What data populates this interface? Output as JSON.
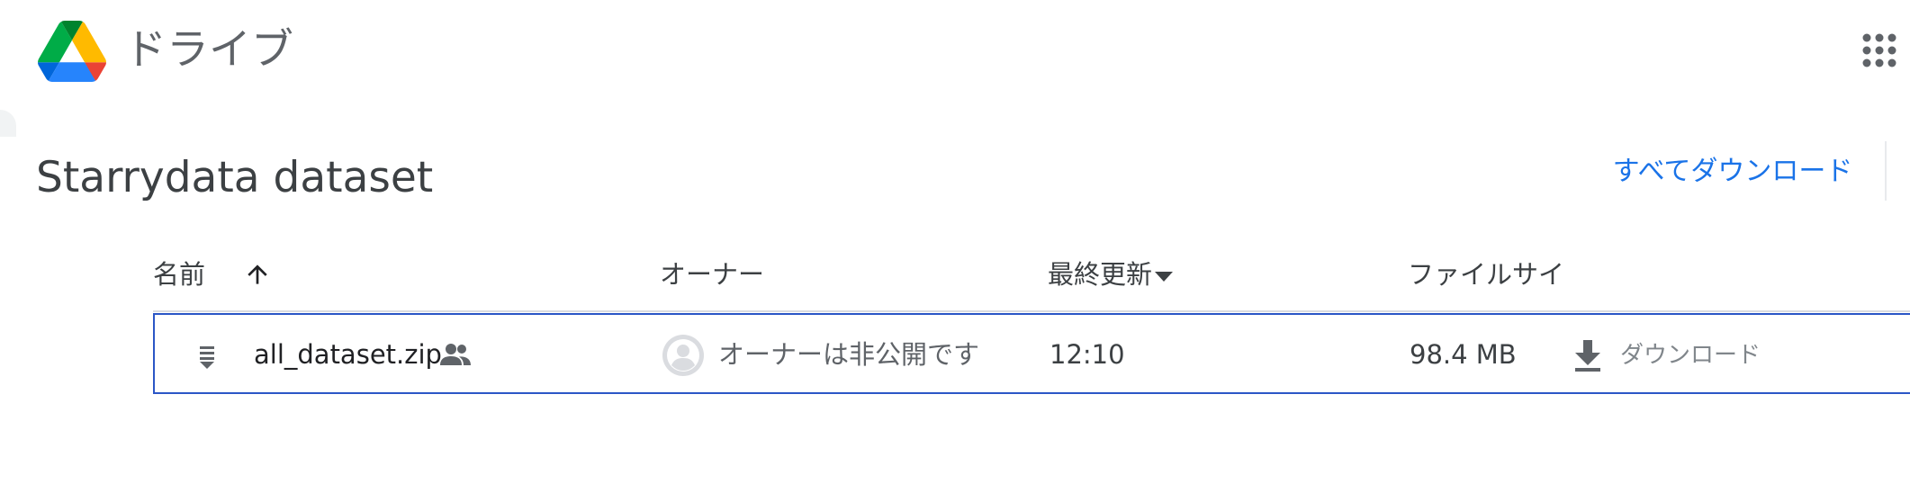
{
  "header": {
    "app_title": "ドライブ",
    "logo_icon": "google-drive-logo",
    "apps_icon": "apps-grid-icon"
  },
  "folder": {
    "title": "Starrydata dataset",
    "download_all_label": "すべてダウンロード"
  },
  "table": {
    "columns": {
      "name": "名前",
      "owner": "オーナー",
      "modified": "最終更新",
      "size": "ファイルサイ"
    },
    "sort": {
      "name_direction": "ascending",
      "modified_indicator": "dropdown"
    },
    "rows": [
      {
        "name": "all_dataset.zip",
        "type_icon": "zip-file-icon",
        "shared_icon": "people-icon",
        "owner": "オーナーは非公開です",
        "owner_icon": "anonymous-avatar-icon",
        "modified": "12:10",
        "size": "98.4 MB",
        "download_label": "ダウンロード",
        "download_icon": "download-icon"
      }
    ]
  },
  "colors": {
    "accent_blue": "#1a73e8",
    "row_border": "#2b56c6",
    "text_primary": "#3c4043",
    "text_secondary": "#5f6368",
    "text_muted": "#80868b"
  }
}
